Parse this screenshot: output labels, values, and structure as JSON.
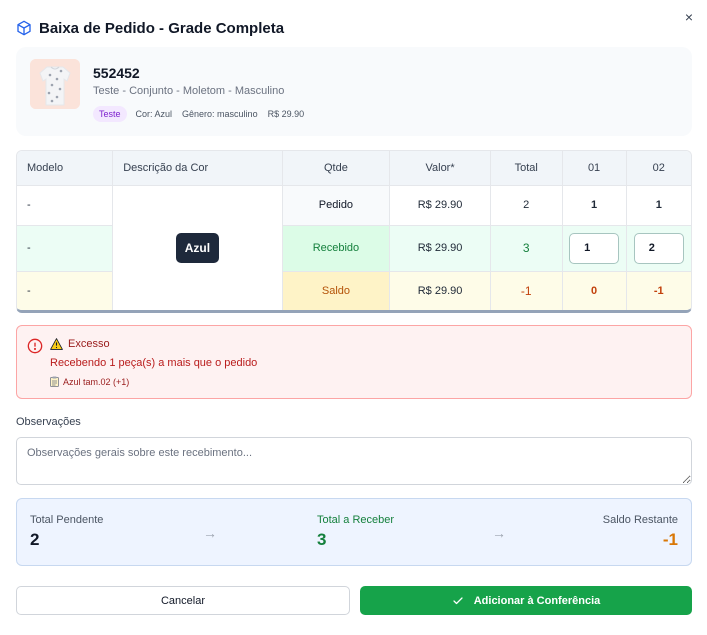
{
  "header": {
    "title": "Baixa de Pedido - Grade Completa",
    "close_symbol": "×",
    "title_icon": "box-icon"
  },
  "product": {
    "code": "552452",
    "description": "Teste - Conjunto - Moletom - Masculino",
    "badge": "Teste",
    "color": "Cor: Azul",
    "gender": "Gênero: masculino",
    "price": "R$ 29.90"
  },
  "grid": {
    "headers": [
      "Modelo",
      "Descrição da Cor",
      "Qtde",
      "Valor*",
      "Total",
      "01",
      "02"
    ],
    "color_badge": "Azul",
    "rows": [
      {
        "modelo": "-",
        "label": "Pedido",
        "valor": "R$ 29.90",
        "total": "2",
        "s01": "1",
        "s02": "1"
      },
      {
        "modelo": "-",
        "label": "Recebido",
        "valor": "R$ 29.90",
        "total": "3",
        "s01": "1",
        "s02": "2"
      },
      {
        "modelo": "-",
        "label": "Saldo",
        "valor": "R$ 29.90",
        "total": "-1",
        "s01": "0",
        "s02": "-1"
      }
    ]
  },
  "alert": {
    "title": "Excesso",
    "message": "Recebendo 1 peça(s) a mais que o pedido",
    "detail": "Azul tam.02 (+1)"
  },
  "observations": {
    "label": "Observações",
    "placeholder": "Observações gerais sobre este recebimento..."
  },
  "summary": {
    "pending_label": "Total Pendente",
    "pending_value": "2",
    "receive_label": "Total a Receber",
    "receive_value": "3",
    "remaining_label": "Saldo Restante",
    "remaining_value": "-1",
    "arrow": "→"
  },
  "actions": {
    "cancel": "Cancelar",
    "confirm": "Adicionar à Conferência"
  },
  "colors": {
    "success": "#16a34a",
    "warning": "#c2410c",
    "danger": "#b91c1c",
    "dark_badge": "#1e293b"
  }
}
